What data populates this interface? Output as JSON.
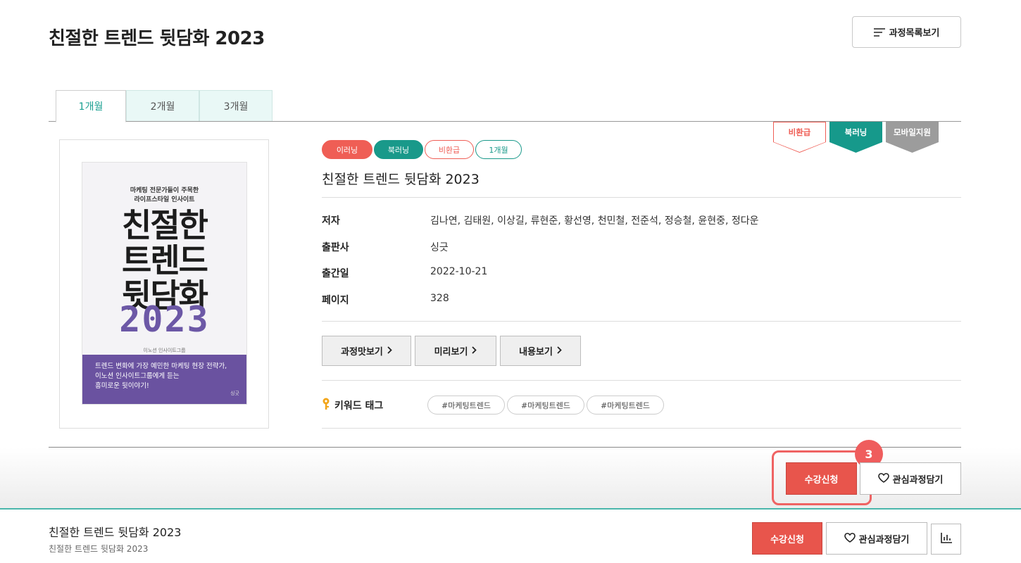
{
  "header": {
    "title": "친절한 트렌드 뒷담화 2023",
    "list_button_label": "과정목록보기"
  },
  "tabs": [
    {
      "label": "1개월",
      "active": true
    },
    {
      "label": "2개월",
      "active": false
    },
    {
      "label": "3개월",
      "active": false
    }
  ],
  "book_cover": {
    "subtitle_lines": [
      "마케팅 전문가들이 주목한",
      "라이프스타일 인사이트"
    ],
    "title_lines": [
      "친절한",
      "트렌드",
      "뒷담화"
    ],
    "year": "2023",
    "publisher_line": "이노션 인사이트그룹",
    "band_lines": [
      "트렌드 변화에 가장 예민한 마케팅 현장 전략가,",
      "이노션 인사이트그룹에게 듣는",
      "흥미로운 뒷이야기!"
    ],
    "logo": "싱긋"
  },
  "chips": [
    "이러닝",
    "북러닝",
    "비환급",
    "1개월"
  ],
  "ribbons": [
    "비환급",
    "북러닝",
    "모바일지원"
  ],
  "course": {
    "title": "친절한 트렌드 뒷담화 2023",
    "info": [
      {
        "label": "저자",
        "value": "김나연, 김태원, 이상길, 류현준, 황선영, 천민철, 전준석, 정승철, 윤현중, 정다운"
      },
      {
        "label": "출판사",
        "value": "싱긋"
      },
      {
        "label": "출간일",
        "value": "2022-10-21"
      },
      {
        "label": "페이지",
        "value": "328"
      }
    ]
  },
  "actions": [
    "과정맛보기",
    "미리보기",
    "내용보기"
  ],
  "keywords": {
    "label": "키워드 태그",
    "tags": [
      "#마케팅트렌드",
      "#마케팅트렌드",
      "#마케팅트렌드"
    ]
  },
  "cta": {
    "enroll_label": "수강신청",
    "wishlist_label": "관심과정담기",
    "step_number": "3"
  },
  "bottom_bar": {
    "title": "친절한 트렌드 뒷담화 2023",
    "subtitle": "친절한 트렌드 뒷담화 2023",
    "enroll_label": "수강신청",
    "wishlist_label": "관심과정담기"
  },
  "colors": {
    "accent_red": "#e8554c",
    "accent_teal": "#19998a",
    "book_purple": "#6a52a0"
  }
}
